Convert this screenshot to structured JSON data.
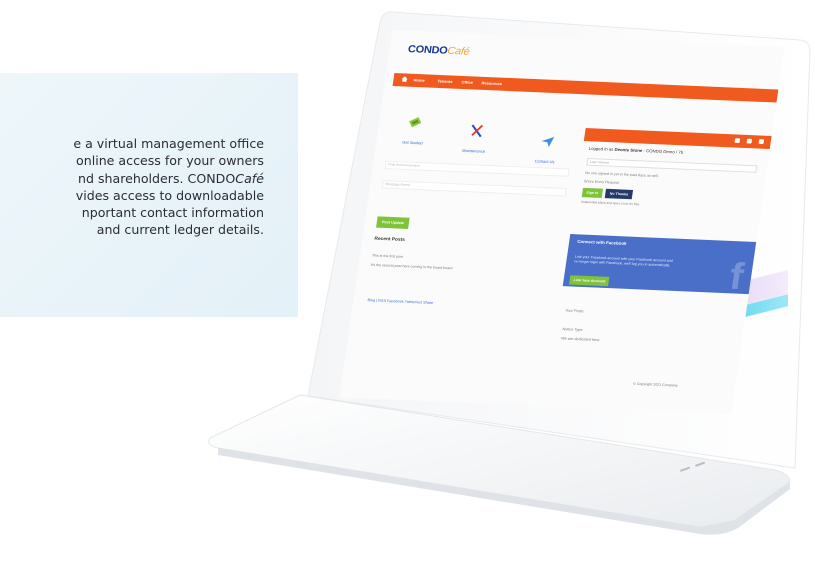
{
  "info_panel": {
    "lines": [
      "e a virtual management office",
      "online access for your owners",
      "nd shareholders. CONDO",
      "vides access to downloadable",
      "nportant contact information",
      "and current ledger details."
    ],
    "line3_italic": "Café"
  },
  "screen": {
    "logo_main": "CONDO",
    "logo_accent": "Café",
    "nav_items": [
      "Home",
      "Tenants",
      "Office",
      "Resources"
    ],
    "logged_in_prefix": "Logged in as",
    "logged_in_user": "Deonte Stone",
    "logged_in_suffix": "- CONDO Demo / 75",
    "tiles": [
      "Get Started",
      "Maintenance",
      "Contact Us"
    ],
    "sidebar": {
      "search_placeholder": "Last Viewed",
      "help_text": "No one signed in yet in the past days as well.",
      "remember_text": "Share Every Request",
      "btn_sign": "Sign In",
      "btn_no_thanks": "No Thanks",
      "small_text": "Suspended plans and open a line for free"
    },
    "facebook": {
      "title": "Connect with Facebook",
      "body": "Link your Facebook account with your Facebook account and no longer login with Facebook, we'll log you in automatically.",
      "button": "Link Your Account",
      "f_glyph": "f"
    },
    "main": {
      "field1": "Post Announcement",
      "field2": "Message Board",
      "green_button": "Post Update",
      "recent_post_title": "Recent Posts",
      "post_lines": [
        "This is the first post",
        "It's the second post here coming in the board board"
      ],
      "footer_links": "Blog  |  RSS  Facebook  Twitter/ect  Share"
    },
    "side_lower": [
      "Your Posts",
      "Notice Type",
      "We are dedicated here"
    ],
    "copyright": "© Copyright 2021 Company"
  },
  "colors": {
    "orange": "#f05a1e",
    "green": "#7ec43a",
    "navy": "#253a6a",
    "facebook_blue": "#4a6fc9",
    "panel_bg": "#e8f4f9"
  }
}
